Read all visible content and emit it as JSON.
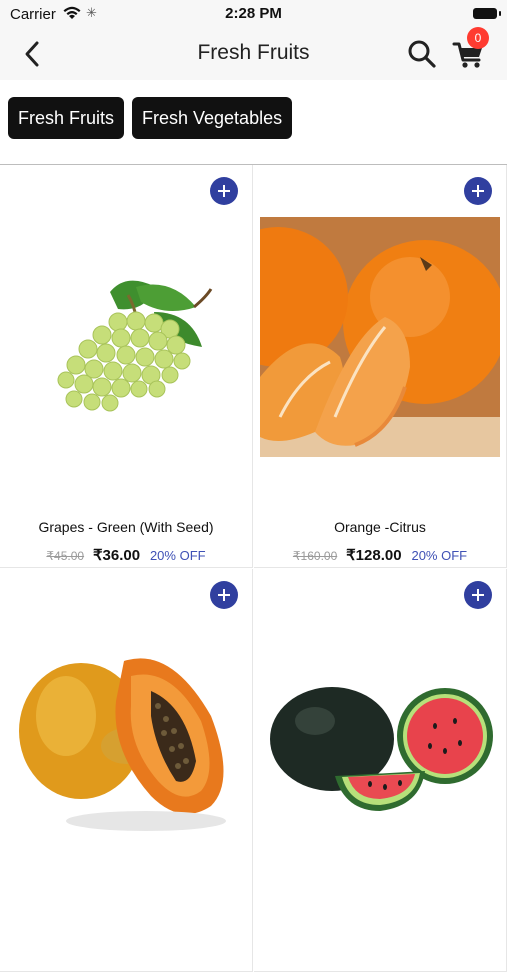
{
  "status_bar": {
    "carrier": "Carrier",
    "time": "2:28 PM"
  },
  "header": {
    "title": "Fresh Fruits",
    "cart_count": "0"
  },
  "categories": [
    {
      "label": "Fresh Fruits"
    },
    {
      "label": "Fresh Vegetables"
    }
  ],
  "products": [
    {
      "name": "Grapes - Green (With Seed)",
      "mrp": "₹45.00",
      "price": "₹36.00",
      "discount": "20% OFF"
    },
    {
      "name": "Orange -Citrus",
      "mrp": "₹160.00",
      "price": "₹128.00",
      "discount": "20% OFF"
    },
    {
      "name": "",
      "mrp": "",
      "price": "",
      "discount": ""
    },
    {
      "name": "",
      "mrp": "",
      "price": "",
      "discount": ""
    }
  ],
  "colors": {
    "accent": "#303f9f",
    "badge": "#ff3b30",
    "chip_bg": "#111111",
    "discount_text": "#3f51b5"
  }
}
